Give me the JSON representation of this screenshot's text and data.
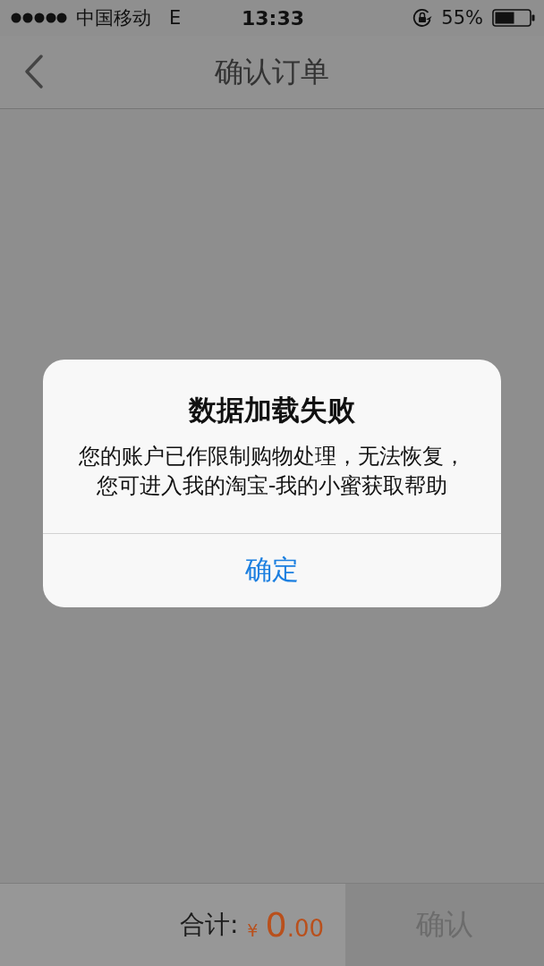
{
  "status_bar": {
    "carrier": "中国移动",
    "network": "E",
    "time": "13:33",
    "battery_text": "55%"
  },
  "nav_bar": {
    "title": "确认订单"
  },
  "bottom_bar": {
    "total_label": "合计:",
    "currency": "¥",
    "amount_integer": "0",
    "amount_decimal": ".00",
    "confirm_button": {
      "label": "确认",
      "disabled": true
    }
  },
  "dialog": {
    "title": "数据加载失败",
    "message": "您的账户已作限制购物处理，无法恢复，您可进入我的淘宝-我的小蜜获取帮助",
    "buttons": [
      {
        "label": "确定"
      }
    ]
  }
}
